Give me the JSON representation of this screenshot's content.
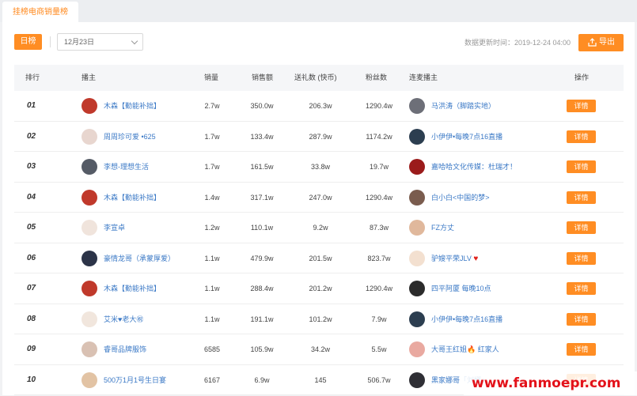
{
  "tab": "挂榜电商销量榜",
  "toolbar": {
    "day_label": "日榜",
    "date_value": "12月23日",
    "update_time": "数据更新时间：2019-12-24 04:00",
    "export_label": "导出"
  },
  "columns": {
    "rank": "排行",
    "anchor": "播主",
    "sales": "销量",
    "amount": "销售额",
    "gift": "送礼数 (快币)",
    "fans": "粉丝数",
    "linked": "连麦播主",
    "action": "操作"
  },
  "detail_label": "详情",
  "colors": {
    "accent": "#ff8d23",
    "link": "#3b79c6"
  },
  "rows": [
    {
      "rank": "01",
      "anchor": "木森【勤能补拙】",
      "sales": "2.7w",
      "amount": "350.0w",
      "gift": "206.3w",
      "fans": "1290.4w",
      "linked": "马洪涛（脚踏实地）",
      "linked_suffix": ""
    },
    {
      "rank": "02",
      "anchor": "周周珍可爱 •625",
      "sales": "1.7w",
      "amount": "133.4w",
      "gift": "287.9w",
      "fans": "1174.2w",
      "linked": "小伊伊•每晚7点16直播",
      "linked_suffix": ""
    },
    {
      "rank": "03",
      "anchor": "李想-理想生活",
      "sales": "1.7w",
      "amount": "161.5w",
      "gift": "33.8w",
      "fans": "19.7w",
      "linked": "嘉哈哈文化传媒：杜瑞才！",
      "linked_suffix": ""
    },
    {
      "rank": "04",
      "anchor": "木森【勤能补拙】",
      "sales": "1.4w",
      "amount": "317.1w",
      "gift": "247.0w",
      "fans": "1290.4w",
      "linked": "白小白<中国的梦>",
      "linked_suffix": ""
    },
    {
      "rank": "05",
      "anchor": "李宣卓",
      "sales": "1.2w",
      "amount": "110.1w",
      "gift": "9.2w",
      "fans": "87.3w",
      "linked": "FZ方丈",
      "linked_suffix": ""
    },
    {
      "rank": "06",
      "anchor": "豪情龙哥（承蒙厚爱）",
      "sales": "1.1w",
      "amount": "479.9w",
      "gift": "201.5w",
      "fans": "823.7w",
      "linked": "驴嫂平荣JLV",
      "linked_suffix": "♥"
    },
    {
      "rank": "07",
      "anchor": "木森【勤能补拙】",
      "sales": "1.1w",
      "amount": "288.4w",
      "gift": "201.2w",
      "fans": "1290.4w",
      "linked": "四平阿厦 每晚10点",
      "linked_suffix": ""
    },
    {
      "rank": "08",
      "anchor": "艾米♥老大㊗",
      "sales": "1.1w",
      "amount": "191.1w",
      "gift": "101.2w",
      "fans": "7.9w",
      "linked": "小伊伊•每晚7点16直播",
      "linked_suffix": ""
    },
    {
      "rank": "09",
      "anchor": "睿哥品牌服饰",
      "sales": "6585",
      "amount": "105.9w",
      "gift": "34.2w",
      "fans": "5.5w",
      "linked": "大哥王红姐🔥 红家人",
      "linked_suffix": ""
    },
    {
      "rank": "10",
      "anchor": "500万1月1号生日宴",
      "sales": "6167",
      "amount": "6.9w",
      "gift": "145",
      "fans": "506.7w",
      "linked": "黑家娜哥「刘娜」",
      "linked_suffix": ""
    }
  ],
  "watermark": "www.fanmoepr.com"
}
